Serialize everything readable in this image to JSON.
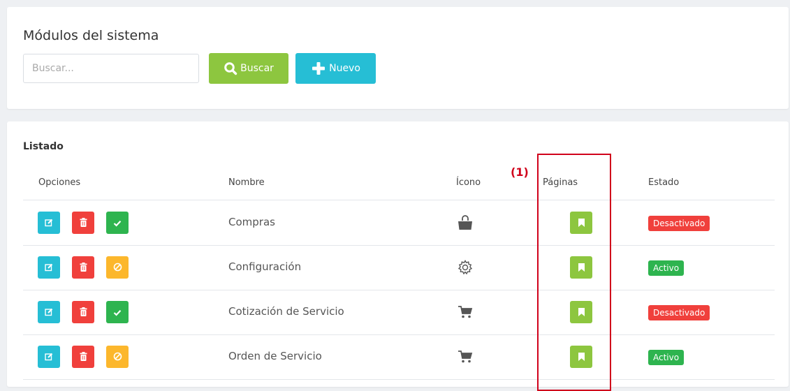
{
  "header": {
    "title": "Módulos del sistema",
    "search_placeholder": "Buscar...",
    "search_button": "Buscar",
    "new_button": "Nuevo"
  },
  "list": {
    "title": "Listado",
    "columns": [
      "Opciones",
      "Nombre",
      "Ícono",
      "Páginas",
      "Estado"
    ],
    "rows": [
      {
        "name": "Compras",
        "icon": "shopping-bag-icon",
        "toggle": "enable-icon",
        "status": "Desactivado"
      },
      {
        "name": "Configuración",
        "icon": "gear-icon",
        "toggle": "disable-icon",
        "status": "Activo"
      },
      {
        "name": "Cotización de Servicio",
        "icon": "cart-icon",
        "toggle": "enable-icon",
        "status": "Desactivado"
      },
      {
        "name": "Orden de Servicio",
        "icon": "cart-icon",
        "toggle": "disable-icon",
        "status": "Activo"
      }
    ]
  },
  "annotation": {
    "label": "(1)"
  },
  "colors": {
    "green": "#8dc63f",
    "cyan": "#26bed5",
    "red": "#f0403c",
    "dark_green": "#2eb44f",
    "yellow": "#fcb72c",
    "annotation_red": "#d0021b"
  }
}
